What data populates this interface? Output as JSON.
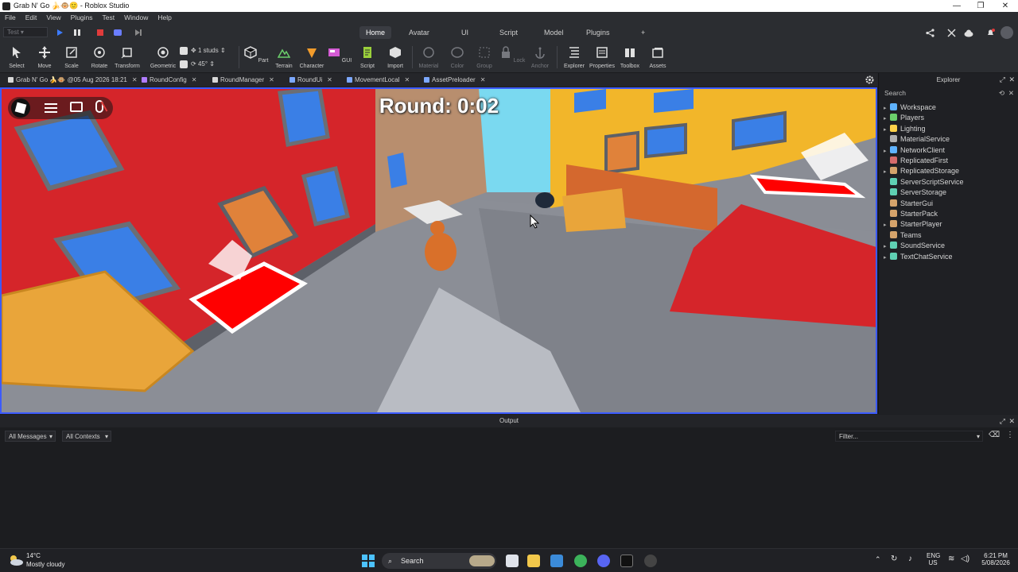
{
  "window": {
    "title": "Grab N' Go 🍌🐵🙂 - Roblox Studio"
  },
  "menu": [
    "File",
    "Edit",
    "View",
    "Plugins",
    "Test",
    "Window",
    "Help"
  ],
  "ribbon_tabs": [
    "Home",
    "Avatar",
    "UI",
    "Script",
    "Model",
    "Plugins"
  ],
  "ribbon_active_tab": "Home",
  "play_mode": "Test",
  "tools": {
    "select": "Select",
    "move": "Move",
    "scale": "Scale",
    "rotate": "Rotate",
    "transform": "Transform",
    "geometric": "Geometric",
    "studs": "1 studs",
    "angle": "45°",
    "part": "Part",
    "terrain": "Terrain",
    "character": "Character",
    "gui": "GUI",
    "script": "Script",
    "import": "Import",
    "material": "Material",
    "color": "Color",
    "group": "Group",
    "lock": "Lock",
    "anchor": "Anchor",
    "explorer": "Explorer",
    "properties": "Properties",
    "toolbox": "Toolbox",
    "assets": "Assets"
  },
  "doc_tabs": [
    {
      "label": "Grab N' Go 🍌🐵 @05 Aug 2026 18:21",
      "color": "#d8d8d8"
    },
    {
      "label": "RoundConfig",
      "color": "#b07cff"
    },
    {
      "label": "RoundManager",
      "color": "#d8d8d8"
    },
    {
      "label": "RoundUi",
      "color": "#7ca8ff"
    },
    {
      "label": "MovementLocal",
      "color": "#7ca8ff"
    },
    {
      "label": "AssetPreloader",
      "color": "#7ca8ff"
    }
  ],
  "game": {
    "round_label": "Round: 0:02"
  },
  "explorer": {
    "title": "Explorer",
    "search_placeholder": "Search",
    "items": [
      {
        "label": "Workspace",
        "color": "#5fb3ff",
        "expand": true
      },
      {
        "label": "Players",
        "color": "#6bcf6b",
        "expand": true
      },
      {
        "label": "Lighting",
        "color": "#ffd24a",
        "expand": true
      },
      {
        "label": "MaterialService",
        "color": "#b0b0b0",
        "expand": false
      },
      {
        "label": "NetworkClient",
        "color": "#5fb3ff",
        "expand": true
      },
      {
        "label": "ReplicatedFirst",
        "color": "#d56b6b",
        "expand": false
      },
      {
        "label": "ReplicatedStorage",
        "color": "#d5a36b",
        "expand": true
      },
      {
        "label": "ServerScriptService",
        "color": "#5fd0b3",
        "expand": false
      },
      {
        "label": "ServerStorage",
        "color": "#5fd0b3",
        "expand": false
      },
      {
        "label": "StarterGui",
        "color": "#d5a36b",
        "expand": false
      },
      {
        "label": "StarterPack",
        "color": "#d5a36b",
        "expand": false
      },
      {
        "label": "StarterPlayer",
        "color": "#d5a36b",
        "expand": true
      },
      {
        "label": "Teams",
        "color": "#d5a36b",
        "expand": false
      },
      {
        "label": "SoundService",
        "color": "#5fd0b3",
        "expand": true
      },
      {
        "label": "TextChatService",
        "color": "#5fd0b3",
        "expand": true
      }
    ]
  },
  "output": {
    "title": "Output",
    "messages_filter": "All Messages",
    "contexts_filter": "All Contexts",
    "filter_placeholder": "Filter..."
  },
  "taskbar": {
    "weather_temp": "14°C",
    "weather_desc": "Mostly cloudy",
    "search": "Search",
    "lang": "ENG",
    "region": "US",
    "time": "6:21 PM",
    "date": "5/08/2026"
  },
  "colors": {
    "accent_blue": "#3c5bff",
    "stop_red": "#e03b3b"
  }
}
